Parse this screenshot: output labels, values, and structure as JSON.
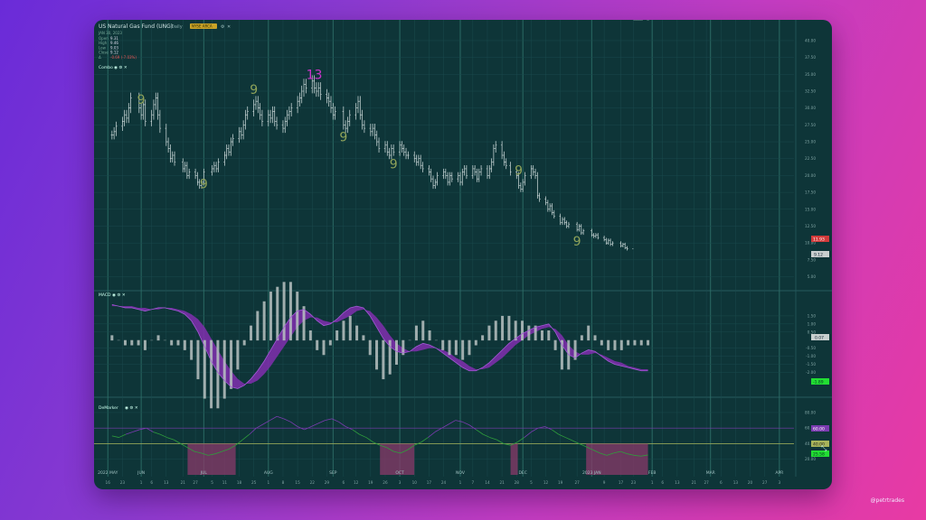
{
  "header": {
    "title": "US Natural Gas Fund (UNG)",
    "interval": "Daily",
    "exchange_badge": "NYSE ARCA",
    "date": "JAN 30, 2023",
    "ohlc": [
      {
        "label": "Open",
        "value": "9.31"
      },
      {
        "label": "High",
        "value": "9.46"
      },
      {
        "label": "Low",
        "value": "9.03"
      },
      {
        "label": "Close",
        "value": "9.12"
      },
      {
        "label": "Δ",
        "value": "-0.69 (-7.03%)"
      }
    ],
    "combo_label": "Combo"
  },
  "panes": {
    "macd_label": "MACD",
    "demarker_label": "DeMarker"
  },
  "price_labels": {
    "red": "11.93",
    "gray": "9.12"
  },
  "macd_labels": {
    "gray": "0.07",
    "green": "-1.89"
  },
  "dem_labels": {
    "purple": "60.00",
    "olive": "40.00",
    "green": "25.58"
  },
  "credit": "@petrtrades",
  "colors": {
    "bg": "#0e3538",
    "grid": "#1a4a4d",
    "candle": "#d7e3e3",
    "signal": "#8fa35a",
    "count13": "#cc33cc",
    "macd_fill": "#7a2fa8",
    "dem_line": "#2f9e3c",
    "dem_line_up": "#7b3bb0",
    "oversold": "#8a3a6a"
  },
  "chart_data": [
    {
      "type": "line",
      "name": "UNG price",
      "x_dates": [
        "2022-05-18",
        "2022-05-19",
        "2022-05-20",
        "2022-05-23",
        "2022-05-24",
        "2022-05-25",
        "2022-05-26",
        "2022-05-27",
        "2022-05-31",
        "2022-06-01",
        "2022-06-02",
        "2022-06-03",
        "2022-06-06",
        "2022-06-07",
        "2022-06-08",
        "2022-06-09",
        "2022-06-10",
        "2022-06-13",
        "2022-06-14",
        "2022-06-15",
        "2022-06-16",
        "2022-06-17",
        "2022-06-21",
        "2022-06-22",
        "2022-06-23",
        "2022-06-24",
        "2022-06-27",
        "2022-06-28",
        "2022-06-29",
        "2022-06-30",
        "2022-07-01",
        "2022-07-05",
        "2022-07-06",
        "2022-07-07",
        "2022-07-08",
        "2022-07-11",
        "2022-07-12",
        "2022-07-13",
        "2022-07-14",
        "2022-07-15",
        "2022-07-18",
        "2022-07-19",
        "2022-07-20",
        "2022-07-21",
        "2022-07-22",
        "2022-07-25",
        "2022-07-26",
        "2022-07-27",
        "2022-07-28",
        "2022-07-29",
        "2022-08-01",
        "2022-08-02",
        "2022-08-03",
        "2022-08-04",
        "2022-08-05",
        "2022-08-08",
        "2022-08-09",
        "2022-08-10",
        "2022-08-11",
        "2022-08-12",
        "2022-08-15",
        "2022-08-16",
        "2022-08-17",
        "2022-08-18",
        "2022-08-19",
        "2022-08-22",
        "2022-08-23",
        "2022-08-24",
        "2022-08-25",
        "2022-08-26",
        "2022-08-29",
        "2022-08-30",
        "2022-08-31",
        "2022-09-01",
        "2022-09-02",
        "2022-09-06",
        "2022-09-07",
        "2022-09-08",
        "2022-09-09",
        "2022-09-12",
        "2022-09-13",
        "2022-09-14",
        "2022-09-15",
        "2022-09-16",
        "2022-09-19",
        "2022-09-20",
        "2022-09-21",
        "2022-09-22",
        "2022-09-23",
        "2022-09-26",
        "2022-09-27",
        "2022-09-28",
        "2022-09-29",
        "2022-09-30",
        "2022-10-03",
        "2022-10-04",
        "2022-10-05",
        "2022-10-06",
        "2022-10-07",
        "2022-10-10",
        "2022-10-11",
        "2022-10-12",
        "2022-10-13",
        "2022-10-14",
        "2022-10-17",
        "2022-10-18",
        "2022-10-19",
        "2022-10-20",
        "2022-10-21",
        "2022-10-24",
        "2022-10-25",
        "2022-10-26",
        "2022-10-27",
        "2022-10-28",
        "2022-10-31",
        "2022-11-01",
        "2022-11-02",
        "2022-11-03",
        "2022-11-04",
        "2022-11-07",
        "2022-11-08",
        "2022-11-09",
        "2022-11-10",
        "2022-11-11",
        "2022-11-14",
        "2022-11-15",
        "2022-11-16",
        "2022-11-17",
        "2022-11-18",
        "2022-11-21",
        "2022-11-22",
        "2022-11-23",
        "2022-11-25",
        "2022-11-28",
        "2022-11-29",
        "2022-11-30",
        "2022-12-01",
        "2022-12-02",
        "2022-12-05",
        "2022-12-06",
        "2022-12-07",
        "2022-12-08",
        "2022-12-09",
        "2022-12-12",
        "2022-12-13",
        "2022-12-14",
        "2022-12-15",
        "2022-12-16",
        "2022-12-19",
        "2022-12-20",
        "2022-12-21",
        "2022-12-22",
        "2022-12-23",
        "2022-12-27",
        "2022-12-28",
        "2022-12-29",
        "2022-12-30",
        "2023-01-03",
        "2023-01-04",
        "2023-01-05",
        "2023-01-06",
        "2023-01-09",
        "2023-01-10",
        "2023-01-11",
        "2023-01-12",
        "2023-01-13",
        "2023-01-17",
        "2023-01-18",
        "2023-01-19",
        "2023-01-20",
        "2023-01-23",
        "2023-01-24",
        "2023-01-25",
        "2023-01-26",
        "2023-01-27",
        "2023-01-30"
      ],
      "close": [
        26.0,
        26.5,
        27.3,
        28.0,
        29.0,
        28.5,
        30.0,
        31.5,
        30.0,
        29.0,
        30.5,
        28.0,
        29.0,
        30.5,
        31.5,
        29.0,
        27.0,
        25.0,
        24.0,
        22.5,
        23.0,
        22.0,
        21.0,
        21.5,
        20.0,
        20.5,
        20.0,
        19.0,
        18.5,
        19.0,
        20.5,
        21.0,
        21.5,
        21.0,
        22.0,
        23.0,
        24.0,
        23.5,
        25.0,
        25.5,
        26.5,
        26.0,
        27.5,
        29.0,
        29.5,
        30.5,
        31.0,
        30.0,
        29.0,
        28.0,
        29.0,
        28.5,
        29.5,
        28.0,
        27.5,
        27.0,
        28.0,
        29.0,
        29.5,
        30.0,
        31.0,
        31.5,
        32.5,
        33.5,
        33.0,
        34.0,
        33.0,
        32.5,
        33.0,
        32.0,
        31.5,
        31.0,
        30.0,
        29.0,
        29.5,
        27.5,
        27.0,
        28.0,
        29.0,
        30.0,
        31.0,
        29.0,
        27.5,
        27.0,
        26.5,
        27.0,
        26.0,
        25.0,
        24.0,
        24.5,
        23.5,
        23.0,
        24.0,
        23.5,
        24.5,
        24.0,
        23.5,
        23.0,
        23.0,
        22.5,
        22.0,
        22.5,
        21.5,
        21.0,
        20.5,
        19.5,
        18.5,
        19.0,
        20.0,
        20.5,
        20.0,
        19.0,
        20.0,
        19.5,
        20.0,
        19.0,
        20.5,
        21.0,
        20.0,
        21.0,
        20.5,
        19.5,
        20.5,
        21.0,
        20.0,
        21.0,
        22.0,
        24.0,
        24.5,
        23.0,
        22.0,
        21.5,
        20.5,
        20.0,
        18.5,
        18.0,
        19.0,
        20.0,
        21.0,
        20.5,
        20.0,
        17.0,
        16.5,
        16.0,
        15.0,
        15.5,
        14.5,
        14.0,
        13.0,
        13.5,
        13.0,
        12.5,
        12.8,
        12.0,
        12.5,
        11.5,
        11.8,
        11.2,
        11.0,
        11.2,
        10.8,
        10.5,
        10.0,
        10.4,
        9.8,
        10.0,
        9.6,
        9.8,
        9.3,
        9.12
      ],
      "signal_nines": [
        {
          "date": "2022-06-01",
          "value": "9"
        },
        {
          "date": "2022-07-01",
          "value": "9"
        },
        {
          "date": "2022-07-25",
          "value": "9"
        },
        {
          "date": "2022-09-06",
          "value": "9"
        },
        {
          "date": "2022-09-30",
          "value": "9"
        },
        {
          "date": "2022-11-29",
          "value": "9"
        },
        {
          "date": "2022-12-27",
          "value": "9"
        },
        {
          "date": "2023-01-30",
          "value": "9"
        }
      ],
      "signal_thirteens": [
        {
          "date": "2022-08-23",
          "value": "13"
        },
        {
          "date": "2023-01-27",
          "value": "13"
        }
      ],
      "y_ticks": [
        "40.00",
        "37.50",
        "35.00",
        "32.50",
        "30.00",
        "27.50",
        "25.00",
        "22.50",
        "20.00",
        "17.50",
        "15.00",
        "12.50",
        "10.00",
        "7.50",
        "5.00"
      ],
      "ylim": [
        4,
        42
      ]
    },
    {
      "type": "bar",
      "name": "MACD",
      "macd_line": [
        2.2,
        2.1,
        2.0,
        2.0,
        1.9,
        1.8,
        1.9,
        2.0,
        2.0,
        1.9,
        1.8,
        1.6,
        1.2,
        0.5,
        -0.4,
        -1.3,
        -2.0,
        -2.5,
        -2.9,
        -3.0,
        -2.8,
        -2.4,
        -1.9,
        -1.3,
        -0.6,
        0.1,
        0.8,
        1.4,
        1.8,
        1.9,
        1.6,
        1.2,
        0.9,
        1.0,
        1.3,
        1.7,
        2.0,
        2.1,
        2.0,
        1.5,
        0.8,
        0.1,
        -0.4,
        -0.7,
        -0.8,
        -0.7,
        -0.4,
        -0.2,
        -0.3,
        -0.5,
        -0.8,
        -1.1,
        -1.4,
        -1.7,
        -1.9,
        -1.9,
        -1.7,
        -1.4,
        -1.0,
        -0.6,
        -0.2,
        0.1,
        0.4,
        0.6,
        0.8,
        0.9,
        1.0,
        0.5,
        -0.3,
        -0.9,
        -1.1,
        -0.8,
        -0.6,
        -0.7,
        -1.0,
        -1.3,
        -1.5,
        -1.6,
        -1.7,
        -1.8,
        -1.9,
        -1.9
      ],
      "signal_line": [
        2.1,
        2.1,
        2.1,
        2.1,
        2.0,
        2.0,
        1.9,
        1.9,
        2.0,
        2.0,
        1.9,
        1.8,
        1.6,
        1.3,
        0.8,
        0.1,
        -0.6,
        -1.3,
        -1.9,
        -2.4,
        -2.7,
        -2.7,
        -2.5,
        -2.1,
        -1.6,
        -1.0,
        -0.4,
        0.2,
        0.8,
        1.2,
        1.4,
        1.4,
        1.2,
        1.1,
        1.1,
        1.3,
        1.5,
        1.8,
        1.9,
        1.8,
        1.4,
        0.9,
        0.3,
        -0.2,
        -0.5,
        -0.7,
        -0.7,
        -0.6,
        -0.5,
        -0.5,
        -0.6,
        -0.8,
        -1.1,
        -1.3,
        -1.6,
        -1.8,
        -1.8,
        -1.7,
        -1.4,
        -1.1,
        -0.7,
        -0.3,
        0.0,
        0.3,
        0.5,
        0.7,
        0.8,
        0.7,
        0.3,
        -0.3,
        -0.7,
        -0.9,
        -0.9,
        -0.8,
        -0.9,
        -1.1,
        -1.3,
        -1.4,
        -1.6,
        -1.7,
        -1.8,
        -1.8
      ],
      "y_ticks": [
        "1.50",
        "1.00",
        "0.50",
        "-0.50",
        "-1.00",
        "-1.50",
        "-2.00"
      ],
      "ylim": [
        -3.2,
        2.5
      ]
    },
    {
      "type": "line",
      "name": "DeMarker",
      "values": [
        50,
        48,
        52,
        55,
        58,
        60,
        55,
        52,
        48,
        45,
        40,
        35,
        30,
        28,
        25,
        27,
        30,
        33,
        38,
        45,
        52,
        60,
        65,
        70,
        75,
        72,
        68,
        62,
        58,
        62,
        66,
        70,
        72,
        68,
        62,
        58,
        52,
        48,
        42,
        38,
        35,
        30,
        28,
        32,
        38,
        42,
        48,
        55,
        60,
        65,
        70,
        68,
        64,
        58,
        52,
        48,
        45,
        40,
        38,
        42,
        48,
        55,
        60,
        62,
        58,
        52,
        48,
        44,
        40,
        36,
        32,
        28,
        25,
        28,
        30,
        27,
        25,
        24,
        25.58
      ],
      "thresholds": [
        60,
        40
      ],
      "y_ticks": [
        "80.00",
        "60.00",
        "40.00",
        "20.00"
      ],
      "ylim": [
        0,
        95
      ]
    }
  ],
  "time_axis": {
    "months": [
      {
        "label": "2022 MAY",
        "date": "2022-05-16"
      },
      {
        "label": "JUN",
        "date": "2022-06-01"
      },
      {
        "label": "JUL",
        "date": "2022-07-01"
      },
      {
        "label": "AUG",
        "date": "2022-08-01"
      },
      {
        "label": "SEP",
        "date": "2022-09-01"
      },
      {
        "label": "OCT",
        "date": "2022-10-03"
      },
      {
        "label": "NOV",
        "date": "2022-11-01"
      },
      {
        "label": "DEC",
        "date": "2022-12-01"
      },
      {
        "label": "2023 JAN",
        "date": "2023-01-03"
      },
      {
        "label": "FEB",
        "date": "2023-02-01"
      },
      {
        "label": "MAR",
        "date": "2023-03-01"
      },
      {
        "label": "APR",
        "date": "2023-04-03"
      }
    ],
    "days": [
      {
        "label": "16",
        "date": "2022-05-16"
      },
      {
        "label": "23",
        "date": "2022-05-23"
      },
      {
        "label": "1",
        "date": "2022-06-01"
      },
      {
        "label": "6",
        "date": "2022-06-06"
      },
      {
        "label": "13",
        "date": "2022-06-13"
      },
      {
        "label": "21",
        "date": "2022-06-21"
      },
      {
        "label": "27",
        "date": "2022-06-27"
      },
      {
        "label": "5",
        "date": "2022-07-05"
      },
      {
        "label": "11",
        "date": "2022-07-11"
      },
      {
        "label": "18",
        "date": "2022-07-18"
      },
      {
        "label": "25",
        "date": "2022-07-25"
      },
      {
        "label": "1",
        "date": "2022-08-01"
      },
      {
        "label": "8",
        "date": "2022-08-08"
      },
      {
        "label": "15",
        "date": "2022-08-15"
      },
      {
        "label": "22",
        "date": "2022-08-22"
      },
      {
        "label": "29",
        "date": "2022-08-29"
      },
      {
        "label": "6",
        "date": "2022-09-06"
      },
      {
        "label": "12",
        "date": "2022-09-12"
      },
      {
        "label": "19",
        "date": "2022-09-19"
      },
      {
        "label": "26",
        "date": "2022-09-26"
      },
      {
        "label": "3",
        "date": "2022-10-03"
      },
      {
        "label": "10",
        "date": "2022-10-10"
      },
      {
        "label": "17",
        "date": "2022-10-17"
      },
      {
        "label": "24",
        "date": "2022-10-24"
      },
      {
        "label": "1",
        "date": "2022-11-01"
      },
      {
        "label": "7",
        "date": "2022-11-07"
      },
      {
        "label": "14",
        "date": "2022-11-14"
      },
      {
        "label": "21",
        "date": "2022-11-21"
      },
      {
        "label": "28",
        "date": "2022-11-28"
      },
      {
        "label": "5",
        "date": "2022-12-05"
      },
      {
        "label": "12",
        "date": "2022-12-12"
      },
      {
        "label": "19",
        "date": "2022-12-19"
      },
      {
        "label": "27",
        "date": "2022-12-27"
      },
      {
        "label": "9",
        "date": "2023-01-09"
      },
      {
        "label": "17",
        "date": "2023-01-17"
      },
      {
        "label": "23",
        "date": "2023-01-23"
      },
      {
        "label": "1",
        "date": "2023-02-01"
      },
      {
        "label": "6",
        "date": "2023-02-06"
      },
      {
        "label": "13",
        "date": "2023-02-13"
      },
      {
        "label": "21",
        "date": "2023-02-21"
      },
      {
        "label": "27",
        "date": "2023-02-27"
      },
      {
        "label": "6",
        "date": "2023-03-06"
      },
      {
        "label": "13",
        "date": "2023-03-13"
      },
      {
        "label": "20",
        "date": "2023-03-20"
      },
      {
        "label": "27",
        "date": "2023-03-27"
      },
      {
        "label": "3",
        "date": "2023-04-03"
      }
    ]
  }
}
